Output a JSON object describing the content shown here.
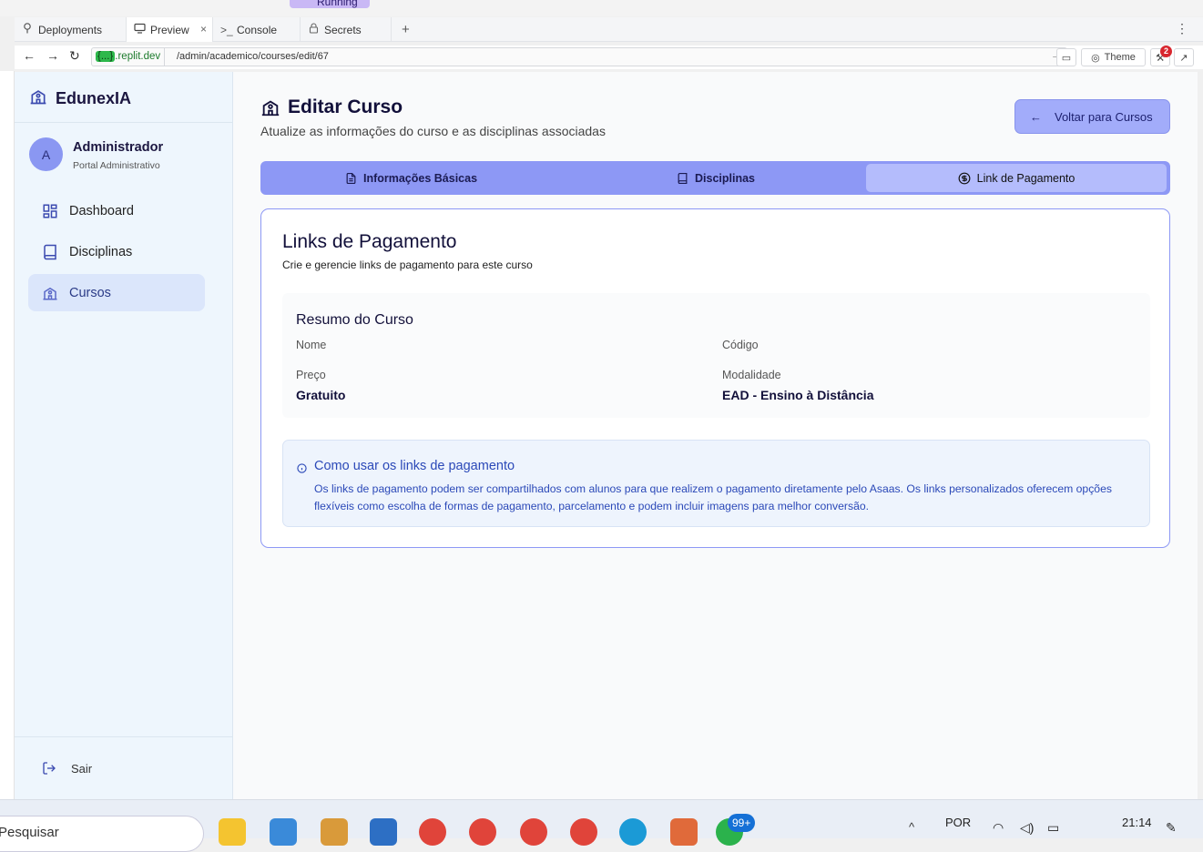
{
  "browser": {
    "running_label": "Running",
    "tabs": [
      {
        "label": "Deployments",
        "icon": "tree-icon"
      },
      {
        "label": "Preview",
        "icon": "monitor-icon",
        "active": true
      },
      {
        "label": "Console",
        "icon": "terminal-icon"
      },
      {
        "label": "Secrets",
        "icon": "lock-icon"
      }
    ],
    "tab_close": "×",
    "add_tab": "+",
    "url_domain_badge": "{...}",
    "url_domain": ".replit.dev",
    "url_path": "/admin/academico/courses/edit/67",
    "theme_label": "Theme",
    "notification_count": "2"
  },
  "sidebar": {
    "brand": "EdunexIA",
    "user_initial": "A",
    "user_name": "Administrador",
    "user_role": "Portal Administrativo",
    "items": [
      {
        "label": "Dashboard",
        "icon": "grid-icon"
      },
      {
        "label": "Disciplinas",
        "icon": "book-icon"
      },
      {
        "label": "Cursos",
        "icon": "school-icon",
        "active": true
      }
    ],
    "logout": "Sair"
  },
  "page": {
    "title": "Editar Curso",
    "subtitle": "Atualize as informações do curso e as disciplinas associadas",
    "back_button": "Voltar para Cursos",
    "tabs": [
      {
        "label": "Informações Básicas",
        "icon": "document-icon"
      },
      {
        "label": "Disciplinas",
        "icon": "book-icon"
      },
      {
        "label": "Link de Pagamento",
        "icon": "dollar-circle-icon",
        "active": true
      }
    ]
  },
  "card": {
    "title": "Links de Pagamento",
    "subtitle": "Crie e gerencie links de pagamento para este curso",
    "summary": {
      "title": "Resumo do Curso",
      "name_label": "Nome",
      "name_value": "",
      "code_label": "Código",
      "code_value": "",
      "price_label": "Preço",
      "price_value": "Gratuito",
      "modality_label": "Modalidade",
      "modality_value": "EAD - Ensino à Distância"
    },
    "info": {
      "title": "Como usar os links de pagamento",
      "text": "Os links de pagamento podem ser compartilhados com alunos para que realizem o pagamento diretamente pelo Asaas. Os links personalizados oferecem opções flexíveis como escolha de formas de pagamento, parcelamento e podem incluir imagens para melhor conversão."
    }
  },
  "taskbar": {
    "search_placeholder": "Pesquisar",
    "notification_badge": "99+",
    "language": "POR",
    "time": "21:14"
  },
  "colors": {
    "accent": "#8d98f5",
    "sidebar_bg": "#eef6fd",
    "info_text": "#2b49b8"
  }
}
